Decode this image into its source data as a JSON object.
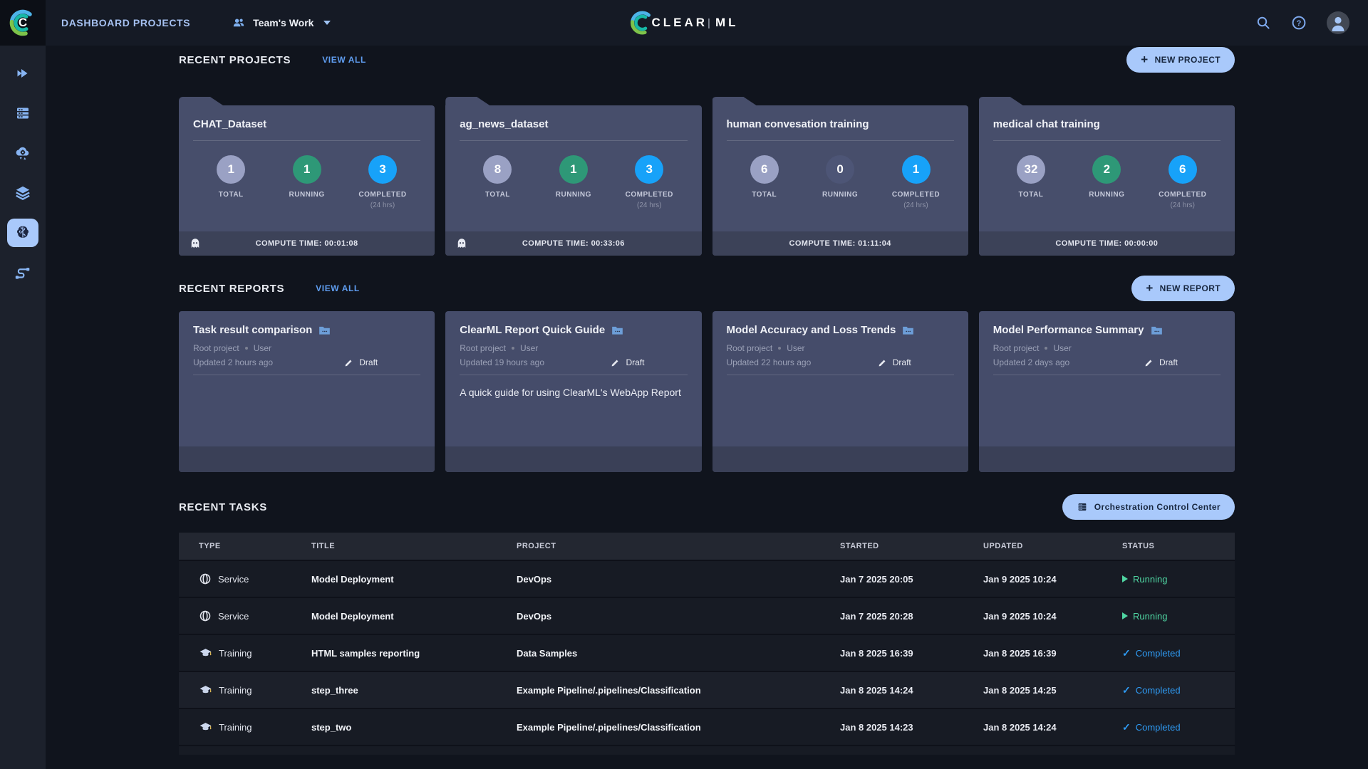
{
  "topbar": {
    "title": "DASHBOARD PROJECTS",
    "workspace": "Team's Work",
    "brand_left": "CLEAR",
    "brand_sep": "|",
    "brand_right": "ML",
    "mark_letter": "C"
  },
  "sidebar": {
    "items": [
      {
        "icon": "double-chevron-right-icon",
        "active": false
      },
      {
        "icon": "workers-queues-icon",
        "active": false
      },
      {
        "icon": "cloud-autoscaler-icon",
        "active": false
      },
      {
        "icon": "datasets-icon",
        "active": false
      },
      {
        "icon": "projects-brain-icon",
        "active": true
      },
      {
        "icon": "pipelines-icon",
        "active": false
      }
    ]
  },
  "projects": {
    "heading": "RECENT PROJECTS",
    "view_all": "VIEW ALL",
    "new_button": "NEW PROJECT",
    "labels": {
      "total": "TOTAL",
      "running": "RUNNING",
      "completed": "COMPLETED",
      "window": "(24 hrs)"
    },
    "cards": [
      {
        "name": "CHAT_Dataset",
        "total": "1",
        "running": "1",
        "completed": "3",
        "compute": "COMPUTE TIME: 00:01:08",
        "has_ghost": true,
        "running_zero": false
      },
      {
        "name": "ag_news_dataset",
        "total": "8",
        "running": "1",
        "completed": "3",
        "compute": "COMPUTE TIME: 00:33:06",
        "has_ghost": true,
        "running_zero": false
      },
      {
        "name": "human convesation training",
        "total": "6",
        "running": "0",
        "completed": "1",
        "compute": "COMPUTE TIME: 01:11:04",
        "has_ghost": false,
        "running_zero": true
      },
      {
        "name": "medical chat training",
        "total": "32",
        "running": "2",
        "completed": "6",
        "compute": "COMPUTE TIME: 00:00:00",
        "has_ghost": false,
        "running_zero": false
      }
    ]
  },
  "reports": {
    "heading": "RECENT REPORTS",
    "view_all": "VIEW ALL",
    "new_button": "NEW REPORT",
    "cards": [
      {
        "title": "Task result comparison",
        "project": "Root project",
        "author": "User",
        "updated": "Updated 2 hours ago",
        "status": "Draft",
        "description": ""
      },
      {
        "title": "ClearML Report Quick Guide",
        "project": "Root project",
        "author": "User",
        "updated": "Updated 19 hours ago",
        "status": "Draft",
        "description": "A quick guide for using ClearML's WebApp Report"
      },
      {
        "title": "Model Accuracy and Loss Trends",
        "project": "Root project",
        "author": "User",
        "updated": "Updated 22 hours ago",
        "status": "Draft",
        "description": ""
      },
      {
        "title": "Model Performance Summary",
        "project": "Root project",
        "author": "User",
        "updated": "Updated 2 days ago",
        "status": "Draft",
        "description": ""
      }
    ]
  },
  "tasks": {
    "heading": "RECENT TASKS",
    "occ_button": "Orchestration Control Center",
    "columns": {
      "type": "TYPE",
      "title": "TITLE",
      "project": "PROJECT",
      "started": "STARTED",
      "updated": "UPDATED",
      "status": "STATUS"
    },
    "rows": [
      {
        "type": "Service",
        "type_icon": "globe-service-icon",
        "title": "Model Deployment",
        "project": "DevOps",
        "started": "Jan 7 2025 20:05",
        "updated": "Jan 9 2025 10:24",
        "status": "Running"
      },
      {
        "type": "Service",
        "type_icon": "globe-service-icon",
        "title": "Model Deployment",
        "project": "DevOps",
        "started": "Jan 7 2025 20:28",
        "updated": "Jan 9 2025 10:24",
        "status": "Running"
      },
      {
        "type": "Training",
        "type_icon": "graduation-cap-icon",
        "title": "HTML samples reporting",
        "project": "Data Samples",
        "started": "Jan 8 2025 16:39",
        "updated": "Jan 8 2025 16:39",
        "status": "Completed"
      },
      {
        "type": "Training",
        "type_icon": "graduation-cap-icon",
        "title": "step_three",
        "project": "Example Pipeline/.pipelines/Classification",
        "started": "Jan 8 2025 14:24",
        "updated": "Jan 8 2025 14:25",
        "status": "Completed"
      },
      {
        "type": "Training",
        "type_icon": "graduation-cap-icon",
        "title": "step_two",
        "project": "Example Pipeline/.pipelines/Classification",
        "started": "Jan 8 2025 14:23",
        "updated": "Jan 8 2025 14:24",
        "status": "Completed"
      }
    ]
  },
  "colors": {
    "page_bg": "#10141d",
    "card_bg": "#474e6b",
    "accent_button": "#a9c9fb",
    "total_circle": "#9aa1c4",
    "running_circle": "#2e9877",
    "running_zero_circle": "#4d5576",
    "completed_circle": "#17a2f9",
    "status_running": "#4fd5a2",
    "status_completed": "#2f9cf5"
  }
}
